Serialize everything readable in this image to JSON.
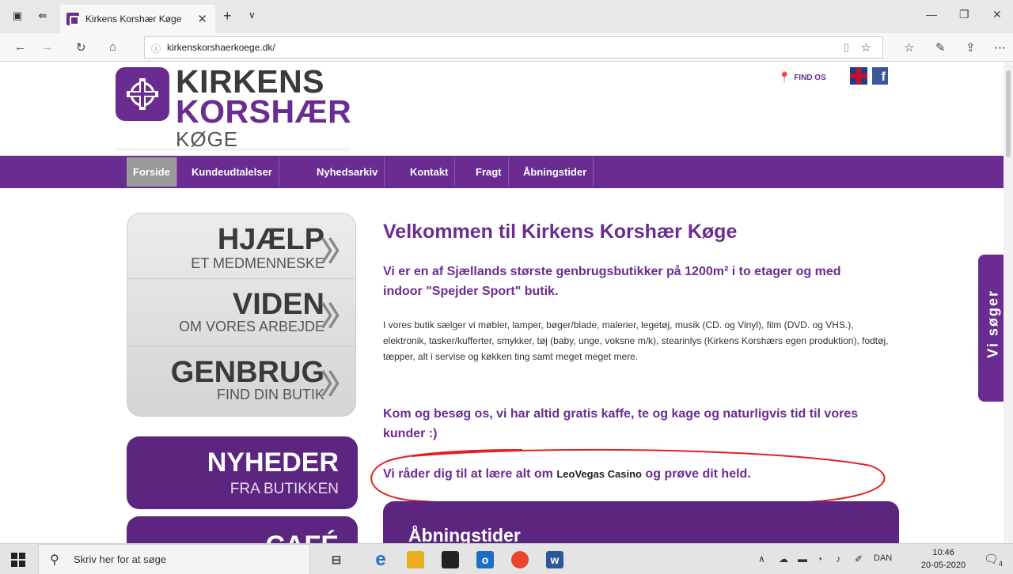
{
  "browser": {
    "tab_title": "Kirkens Korshær Køge",
    "tab_close": "✕",
    "new_tab": "+",
    "tab_list": "∨",
    "minimize": "—",
    "maximize": "❐",
    "close": "✕",
    "url": "kirkenskorshaerkoege.dk/"
  },
  "header": {
    "logo_line1": "KIRKENS",
    "logo_line2": "KORSHÆR",
    "logo_line3": "KØGE",
    "find_os": "FIND OS",
    "facebook": "f"
  },
  "menu": {
    "items": [
      {
        "label": "Forside"
      },
      {
        "label": "Kundeudtalelser"
      },
      {
        "label": "Nyhedsarkiv"
      },
      {
        "label": "Kontakt"
      },
      {
        "label": "Fragt"
      },
      {
        "label": "Åbningstider"
      }
    ]
  },
  "promos": {
    "items": [
      {
        "big": "HJÆLP",
        "small": "ET MEDMENNESKE"
      },
      {
        "big": "VIDEN",
        "small": "OM VORES ARBEJDE"
      },
      {
        "big": "GENBRUG",
        "small": "FIND DIN BUTIK"
      }
    ],
    "news": {
      "big": "NYHEDER",
      "small": "FRA BUTIKKEN"
    },
    "cafe": {
      "big": "CAFÉ"
    }
  },
  "main": {
    "title": "Velkommen til Kirkens Korshær Køge",
    "lead": "Vi er en af Sjællands største genbrugsbutikker på 1200m² i to etager og med indoor \"Spejder Sport\" butik.",
    "body": "I vores butik sælger vi møbler, lamper, bøger/blade, malerier, legetøj, musik (CD. og Vinyl), film (DVD. og VHS.), elektronik, tasker/kufferter, smykker, tøj (baby, unge, voksne m/k), stearinlys (Kirkens Korshærs egen produktion), fodtøj, tæpper, alt i servise og køkken ting samt meget meget mere.",
    "cta": "Kom og besøg os, vi har altid gratis kaffe, te og kage og naturligvis tid til vores kunder :)",
    "casino_pre": "Vi råder dig til at lære alt om ",
    "casino_link": "LeoVegas Casino",
    "casino_post": " og prøve dit held.",
    "hours_title": "Åbningstider"
  },
  "side_tab": "Vi søger",
  "taskbar": {
    "search_placeholder": "Skriv her for at søge",
    "language": "DAN",
    "time": "10:46",
    "date": "20-05-2020",
    "notifications": "4"
  }
}
